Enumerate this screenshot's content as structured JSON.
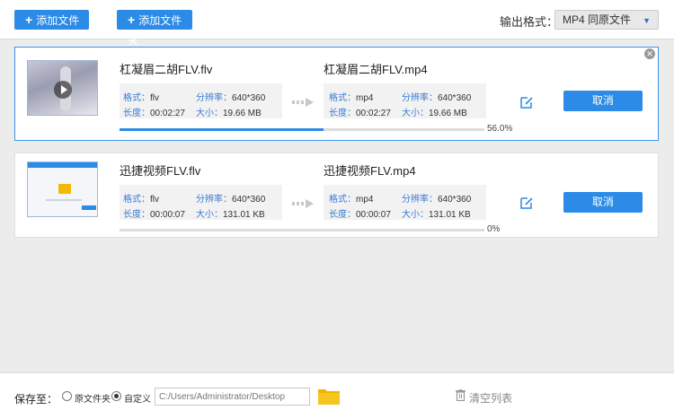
{
  "toolbar": {
    "add_file_label": "添加文件",
    "add_folder_label": "添加文件夹",
    "output_format_label": "输出格式：",
    "output_format_value": "MP4  同原文件"
  },
  "tasks": [
    {
      "source_name": "杠凝眉二胡FLV.flv",
      "target_name": "杠凝眉二胡FLV.mp4",
      "source": {
        "format_key": "格式：",
        "format": "flv",
        "res_key": "分辨率：",
        "resolution": "640*360",
        "dur_key": "长度：",
        "duration": "00:02:27",
        "size_key": "大小：",
        "size": "19.66 MB"
      },
      "target": {
        "format_key": "格式：",
        "format": "mp4",
        "res_key": "分辨率：",
        "resolution": "640*360",
        "dur_key": "长度：",
        "duration": "00:02:27",
        "size_key": "大小：",
        "size": "19.66 MB"
      },
      "cancel_label": "取消",
      "progress": 0.56,
      "progress_text": "56.0%"
    },
    {
      "source_name": "迅捷视频FLV.flv",
      "target_name": "迅捷视频FLV.mp4",
      "source": {
        "format_key": "格式：",
        "format": "flv",
        "res_key": "分辨率：",
        "resolution": "640*360",
        "dur_key": "长度：",
        "duration": "00:00:07",
        "size_key": "大小：",
        "size": "131.01 KB"
      },
      "target": {
        "format_key": "格式：",
        "format": "mp4",
        "res_key": "分辨率：",
        "resolution": "640*360",
        "dur_key": "长度：",
        "duration": "00:00:07",
        "size_key": "大小：",
        "size": "131.01 KB"
      },
      "cancel_label": "取消",
      "progress": 0,
      "progress_text": "0%"
    }
  ],
  "footer": {
    "save_to_label": "保存至：",
    "option_original": "原文件夹",
    "option_custom": "自定义",
    "custom_selected": true,
    "path_value": "C:/Users/Administrator/Desktop",
    "clear_list_label": "清空列表"
  },
  "colors": {
    "accent": "#2b8be6",
    "selected_border": "#3b94e8"
  },
  "icons": [
    "plus-icon",
    "caret-down-icon",
    "play-icon",
    "arrow-right-icon",
    "edit-icon",
    "close-icon",
    "folder-icon",
    "trash-icon"
  ]
}
